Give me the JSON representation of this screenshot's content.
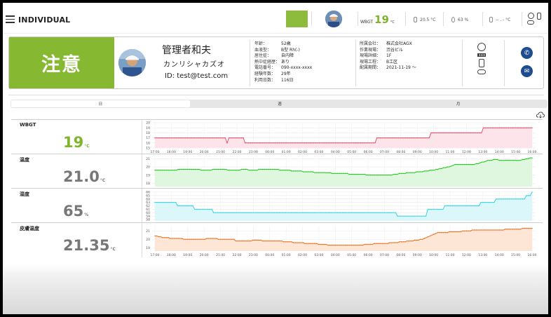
{
  "header": {
    "app_title": "INDIVIDUAL",
    "wbgt_label": "WBGT",
    "wbgt_value": "19",
    "wbgt_unit": "°C",
    "temp": "20.5 °C",
    "humidity": "63 %",
    "skin": "-- . - °C"
  },
  "profile": {
    "alert_label": "注意",
    "name": "管理者和夫",
    "kana": "カンリシャカズオ",
    "user_id": "ID: test@test.com",
    "info": [
      {
        "k": "年齢：",
        "v": "52歳"
      },
      {
        "k": "血液型：",
        "v": "B型 Rh(-)"
      },
      {
        "k": "居住症：",
        "v": "自内障"
      },
      {
        "k": "熱中症経歴：",
        "v": "あり"
      },
      {
        "k": "電話番号：",
        "v": "090-xxxx-xxxx"
      },
      {
        "k": "経験年数：",
        "v": "29年"
      },
      {
        "k": "利用日数：",
        "v": "116日"
      }
    ],
    "work": [
      {
        "k": "所属会社：",
        "v": "株式会社AGX"
      },
      {
        "k": "作業現場：",
        "v": "渋谷ビル"
      },
      {
        "k": "現場詳細：",
        "v": "1F"
      },
      {
        "k": "現場工程：",
        "v": "B工区"
      },
      {
        "k": "配属期間：",
        "v": "2021-11-19 ～"
      }
    ]
  },
  "tabs": [
    {
      "label": "日",
      "active": true
    },
    {
      "label": "週",
      "active": false
    },
    {
      "label": "月",
      "active": false
    }
  ],
  "x_ticks": [
    "17:00",
    "18:00",
    "19:00",
    "20:00",
    "21:00",
    "22:00",
    "23:00",
    "00:00",
    "01:00",
    "02:00",
    "03:00",
    "04:00",
    "05:00",
    "06:00",
    "07:00",
    "08:00",
    "09:00",
    "10:00",
    "11:00",
    "12:00",
    "13:00",
    "14:00",
    "15:00",
    "16:00"
  ],
  "rows": [
    {
      "label": "WBGT",
      "value": "19",
      "unit": "°C",
      "value_color": "#7fb52c"
    },
    {
      "label": "温度",
      "value": "21.0",
      "unit": "°C",
      "value_color": "#777777"
    },
    {
      "label": "湿度",
      "value": "65",
      "unit": "%",
      "value_color": "#777777"
    },
    {
      "label": "皮膚温度",
      "value": "21.35",
      "unit": "°C",
      "value_color": "#777777"
    }
  ],
  "chart_data": [
    {
      "type": "area",
      "name": "WBGT",
      "color": "#e8506a",
      "fill": "#fde4ea",
      "yticks": [
        "15",
        "16",
        "17",
        "18",
        "19",
        "20"
      ],
      "ylim": [
        15,
        20
      ],
      "values": [
        17,
        17,
        17,
        17,
        17,
        17,
        17,
        17,
        17,
        17,
        17,
        17,
        17,
        17,
        17,
        17,
        17,
        17,
        17,
        17,
        17,
        17,
        17,
        17,
        17,
        17,
        17,
        17,
        17,
        17,
        17,
        17,
        17,
        17,
        17,
        17,
        17,
        17,
        17,
        17,
        16,
        17,
        17,
        17,
        17,
        17,
        17,
        17,
        17,
        17,
        16,
        16,
        16,
        16,
        16,
        16,
        16,
        16,
        16,
        16,
        16,
        16,
        16,
        16,
        16,
        16,
        16,
        16,
        16,
        16,
        16,
        16,
        16,
        16,
        16,
        16,
        16,
        16,
        16,
        16,
        16,
        16,
        16,
        16,
        16,
        16,
        16,
        16,
        16,
        16,
        16,
        16,
        16,
        16,
        16,
        16,
        16,
        16,
        16,
        16,
        16,
        16,
        16,
        16,
        16,
        16,
        16,
        16,
        16,
        16,
        16,
        16,
        16,
        16,
        16,
        16,
        16,
        16,
        16,
        16,
        16,
        16,
        16,
        17,
        17,
        17,
        17,
        17,
        17,
        17,
        17,
        17,
        17,
        17,
        17,
        17,
        17,
        17,
        17,
        17,
        17,
        17,
        17,
        17,
        17,
        17,
        17,
        17,
        17,
        17,
        17,
        17,
        17,
        18,
        18,
        18,
        18,
        18,
        18,
        18,
        18,
        18,
        18,
        18,
        18,
        18,
        18,
        18,
        18,
        18,
        18,
        18,
        18,
        18,
        18,
        18,
        18,
        18,
        18,
        18,
        18,
        18,
        19,
        19,
        19,
        19,
        19,
        19,
        19,
        19,
        19,
        19,
        19,
        19,
        19,
        19,
        19,
        19,
        19,
        19,
        19,
        19,
        19,
        19,
        19,
        19,
        19,
        19,
        19,
        19
      ]
    },
    {
      "type": "area",
      "name": "温度",
      "color": "#22cc22",
      "fill": "#dff7df",
      "yticks": [
        "18",
        "19",
        "20",
        "21"
      ],
      "ylim": [
        17.6,
        21.2
      ],
      "values": [
        19.6,
        19.6,
        19.6,
        19.6,
        19.6,
        19.6,
        19.6,
        19.6,
        19.6,
        19.6,
        19.6,
        19.6,
        19.7,
        19.7,
        19.7,
        19.7,
        19.7,
        19.7,
        19.7,
        19.7,
        19.7,
        19.7,
        19.7,
        19.7,
        19.6,
        19.6,
        19.6,
        19.6,
        19.6,
        19.6,
        19.7,
        19.7,
        19.7,
        19.7,
        19.7,
        19.7,
        19.7,
        19.7,
        19.6,
        19.6,
        19.6,
        19.6,
        19.6,
        19.6,
        19.6,
        19.7,
        19.7,
        19.7,
        19.7,
        19.6,
        19.6,
        19.6,
        19.6,
        19.6,
        19.7,
        19.7,
        19.7,
        19.7,
        19.7,
        19.7,
        19.7,
        19.7,
        19.7,
        19.7,
        19.7,
        19.6,
        19.6,
        19.6,
        19.6,
        19.6,
        19.6,
        19.5,
        19.5,
        19.5,
        19.5,
        19.5,
        19.5,
        19.4,
        19.4,
        19.4,
        19.4,
        19.4,
        19.4,
        19.3,
        19.3,
        19.3,
        19.3,
        19.3,
        19.3,
        19.3,
        19.3,
        19.3,
        19.2,
        19.2,
        19.2,
        19.2,
        19.2,
        19.2,
        19.2,
        19.2,
        19.2,
        19.1,
        19.1,
        19.1,
        19.1,
        19.1,
        19.1,
        19.1,
        19.1,
        19.1,
        19.0,
        19.0,
        19.0,
        19.0,
        19.0,
        19.0,
        19.0,
        19.0,
        19.0,
        19.0,
        19.0,
        19.0,
        19.0,
        19.0,
        19.1,
        19.1,
        19.1,
        19.2,
        19.2,
        19.2,
        19.2,
        19.3,
        19.3,
        19.3,
        19.3,
        19.3,
        19.4,
        19.4,
        19.4,
        19.4,
        19.5,
        19.5,
        19.5,
        19.6,
        19.6,
        19.6,
        19.7,
        19.7,
        19.8,
        19.8,
        19.9,
        19.9,
        20.0,
        20.0,
        20.1,
        20.2,
        20.3,
        20.3,
        20.3,
        20.3,
        20.3,
        20.3,
        20.3,
        20.3,
        20.3,
        20.3,
        20.3,
        20.4,
        20.4,
        20.5,
        20.6,
        20.6,
        20.7,
        20.8,
        20.8,
        20.8,
        20.9,
        20.9,
        20.9,
        20.8,
        20.8,
        20.8,
        20.8,
        20.8,
        20.8,
        20.8,
        20.8,
        20.8,
        20.8,
        20.8,
        20.8,
        20.9,
        20.9,
        21.0,
        21.0,
        21.1,
        21.1
      ]
    },
    {
      "type": "area",
      "name": "湿度",
      "color": "#33d6e6",
      "fill": "#dcf7fa",
      "yticks": [
        "58",
        "59",
        "60",
        "61",
        "62",
        "63",
        "64",
        "65",
        "66"
      ],
      "ylim": [
        57.6,
        66.2
      ],
      "values": [
        63,
        63,
        63,
        63,
        63,
        63,
        63,
        63,
        63,
        63,
        63,
        63,
        62,
        62,
        62,
        62,
        62,
        62,
        62,
        62,
        62,
        61,
        61,
        61,
        61,
        61,
        61,
        61,
        61,
        61,
        61,
        60,
        60,
        60,
        60,
        60,
        60,
        60,
        60,
        60,
        60,
        60,
        60,
        60,
        60,
        60,
        60,
        60,
        60,
        60,
        60,
        60,
        60,
        60,
        60,
        60,
        60,
        60,
        60,
        60,
        60,
        60,
        60,
        60,
        60,
        60,
        60,
        60,
        60,
        60,
        60,
        60,
        60,
        60,
        60,
        60,
        60,
        60,
        60,
        60,
        60,
        60,
        60,
        60,
        60,
        60,
        60,
        60,
        60,
        60,
        60,
        60,
        60,
        60,
        60,
        60,
        60,
        60,
        60,
        60,
        60,
        60,
        60,
        60,
        60,
        60,
        60,
        60,
        60,
        60,
        60,
        60,
        60,
        60,
        60,
        60,
        60,
        60,
        60,
        60,
        60,
        60,
        60,
        60,
        60,
        60,
        60,
        60,
        59,
        59,
        59,
        59,
        59,
        59,
        59,
        59,
        59,
        59,
        59,
        59,
        59,
        59,
        59,
        59,
        61,
        61,
        61,
        61,
        61,
        61,
        61,
        61,
        61,
        62,
        62,
        62,
        62,
        62,
        62,
        62,
        62,
        62,
        62,
        62,
        62,
        62,
        62,
        62,
        62,
        62,
        62,
        62,
        63,
        63,
        63,
        63,
        63,
        63,
        63,
        63,
        64,
        64,
        64,
        64,
        64,
        64,
        64,
        64,
        64,
        64,
        64,
        64,
        64,
        64,
        64,
        64,
        65,
        65,
        65,
        66
      ]
    },
    {
      "type": "area",
      "name": "皮膚温度",
      "color": "#f07020",
      "fill": "#fde6d6",
      "yticks": [
        "19",
        "20",
        "21"
      ],
      "ylim": [
        18.6,
        21.6
      ],
      "values": [
        20.4,
        20.4,
        20.3,
        20.3,
        20.2,
        20.2,
        20.2,
        20.2,
        20.1,
        20.1,
        20.1,
        20.1,
        20.1,
        20.1,
        20.1,
        20.0,
        20.0,
        20.0,
        20.0,
        20.0,
        20.0,
        20.0,
        20.0,
        20.0,
        20.0,
        20.0,
        20.0,
        20.1,
        20.1,
        20.1,
        20.1,
        20.1,
        20.1,
        20.0,
        20.0,
        20.0,
        20.0,
        20.0,
        20.0,
        20.0,
        20.0,
        20.0,
        19.8,
        19.8,
        19.8,
        19.8,
        19.8,
        19.8,
        19.8,
        19.8,
        19.8,
        19.9,
        19.9,
        19.9,
        19.9,
        19.9,
        19.8,
        19.8,
        19.8,
        19.8,
        19.8,
        19.8,
        19.8,
        19.8,
        19.8,
        19.8,
        19.8,
        19.7,
        19.7,
        19.7,
        19.7,
        19.7,
        19.6,
        19.6,
        19.6,
        19.6,
        19.6,
        19.6,
        19.5,
        19.5,
        19.5,
        19.5,
        19.5,
        19.5,
        19.5,
        19.4,
        19.4,
        19.4,
        19.4,
        19.4,
        19.3,
        19.3,
        19.3,
        19.3,
        19.3,
        19.3,
        19.3,
        19.3,
        19.3,
        19.3,
        19.3,
        19.3,
        19.3,
        19.3,
        19.3,
        19.3,
        19.3,
        19.3,
        19.3,
        19.4,
        19.4,
        19.4,
        19.4,
        19.4,
        19.5,
        19.5,
        19.5,
        19.5,
        19.5,
        19.5,
        19.5,
        19.5,
        19.6,
        19.6,
        19.6,
        19.6,
        19.6,
        19.7,
        19.7,
        19.7,
        19.7,
        19.8,
        19.8,
        19.8,
        19.8,
        19.9,
        19.9,
        19.9,
        20.0,
        20.0,
        20.1,
        20.2,
        20.3,
        20.4,
        20.5,
        20.6,
        20.7,
        20.8,
        20.8,
        20.8,
        20.8,
        20.8,
        20.8,
        20.9,
        20.9,
        20.9,
        20.9,
        20.9,
        20.9,
        20.9,
        21.0,
        21.0,
        21.0,
        21.0,
        21.0,
        21.1,
        21.1,
        21.1,
        21.1,
        21.1,
        21.1,
        21.1,
        21.1,
        21.1,
        21.1,
        21.1,
        21.1,
        21.1,
        21.1,
        21.1,
        21.1,
        21.1,
        21.2,
        21.2,
        21.2,
        21.2,
        21.2,
        21.2,
        21.2,
        21.2,
        21.2,
        21.3,
        21.3,
        21.3,
        21.3,
        21.3,
        21.3
      ]
    }
  ]
}
